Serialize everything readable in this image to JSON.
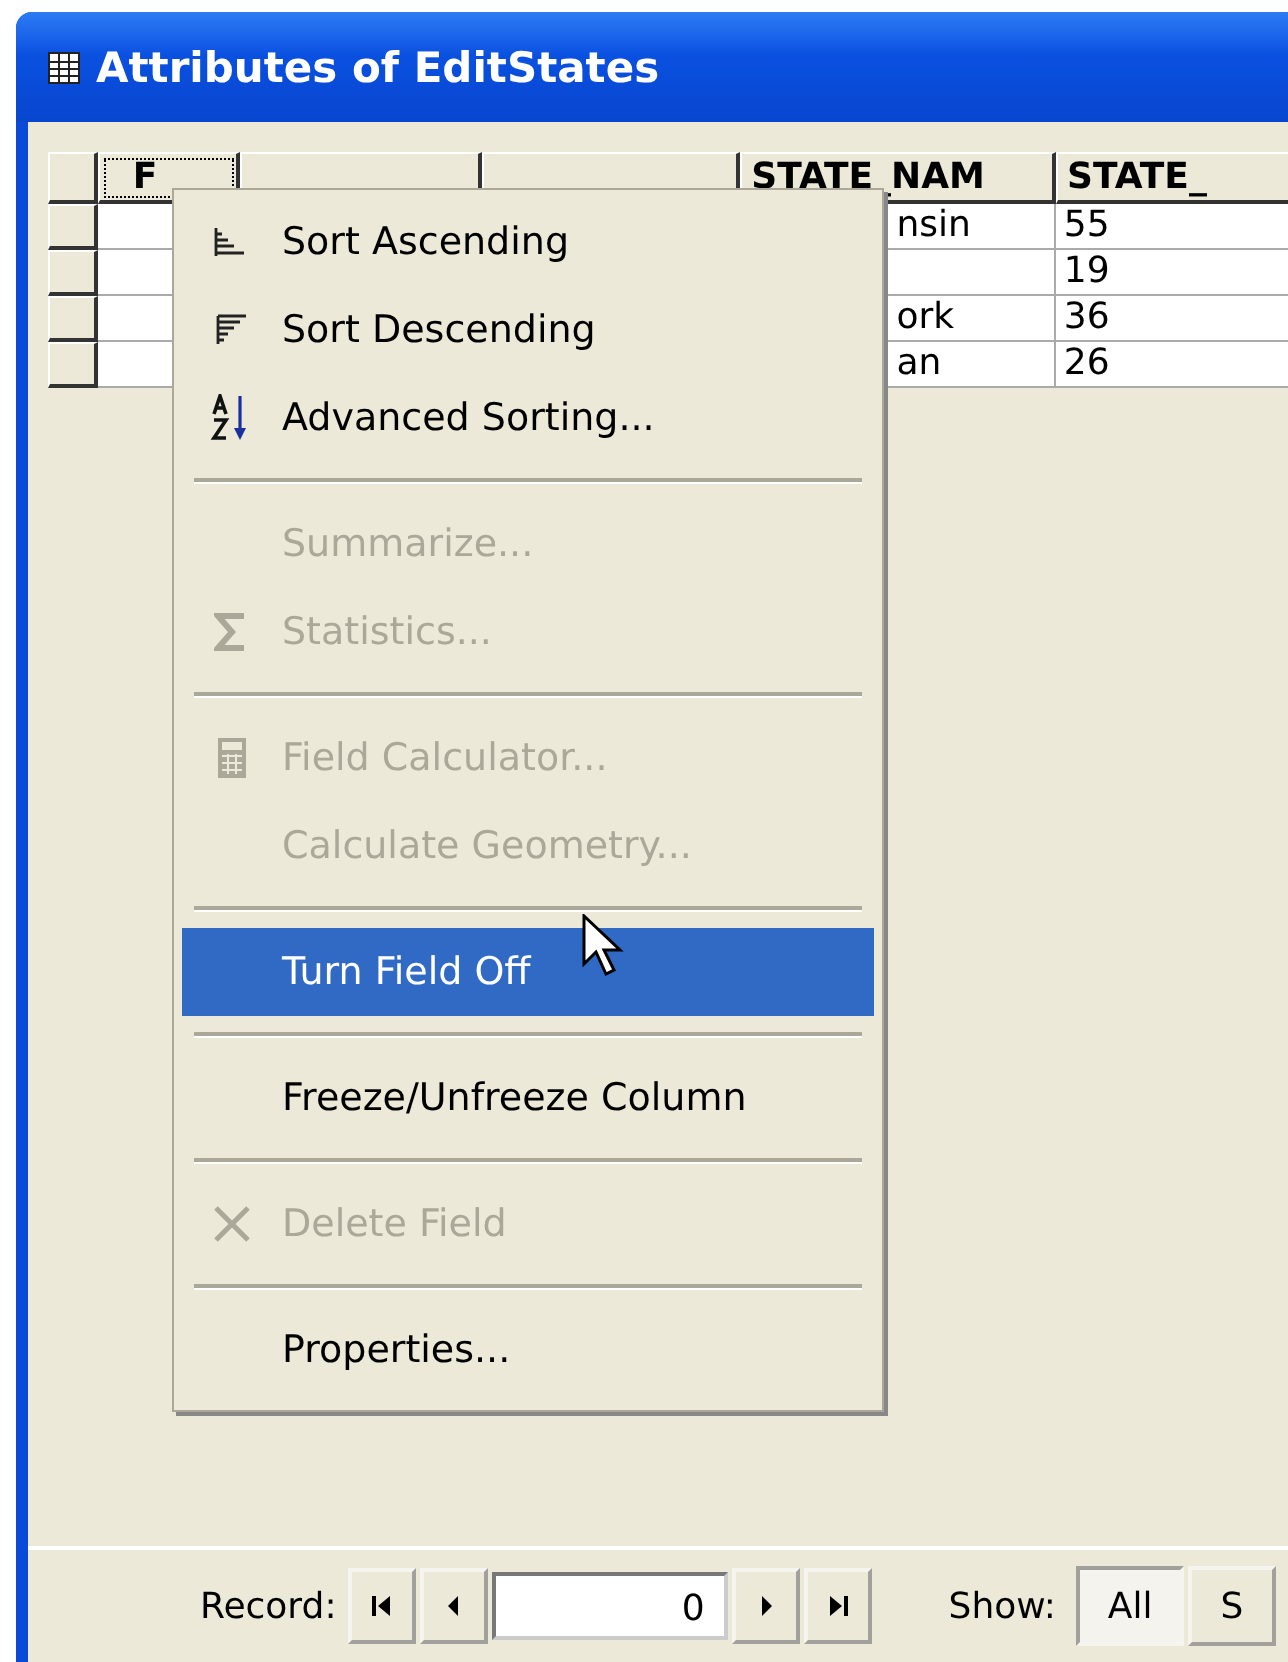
{
  "window": {
    "title": "Attributes of EditStates"
  },
  "table": {
    "columns": [
      {
        "label": "F"
      },
      {},
      {},
      {
        "label": "STATE_NAM"
      },
      {
        "label": "STATE_"
      }
    ],
    "rows": [
      {
        "cells": [
          "",
          "",
          "",
          "nsin",
          "55"
        ]
      },
      {
        "cells": [
          "",
          "",
          "",
          "",
          "19"
        ]
      },
      {
        "cells": [
          "",
          "",
          "",
          "ork",
          "36"
        ]
      },
      {
        "cells": [
          "",
          "",
          "",
          "an",
          "26"
        ]
      }
    ]
  },
  "menu": {
    "items": [
      {
        "kind": "item",
        "label": "Sort Ascending",
        "disabled": false,
        "selected": false
      },
      {
        "kind": "item",
        "label": "Sort Descending",
        "disabled": false,
        "selected": false
      },
      {
        "kind": "item",
        "label": "Advanced Sorting...",
        "disabled": false,
        "selected": false
      },
      {
        "kind": "separator"
      },
      {
        "kind": "item",
        "label": "Summarize...",
        "disabled": true,
        "selected": false
      },
      {
        "kind": "item",
        "label": "Statistics...",
        "disabled": true,
        "selected": false
      },
      {
        "kind": "separator"
      },
      {
        "kind": "item",
        "label": "Field Calculator...",
        "disabled": true,
        "selected": false
      },
      {
        "kind": "item",
        "label": "Calculate Geometry...",
        "disabled": true,
        "selected": false
      },
      {
        "kind": "separator"
      },
      {
        "kind": "item",
        "label": "Turn Field Off",
        "disabled": false,
        "selected": true
      },
      {
        "kind": "separator"
      },
      {
        "kind": "item",
        "label": "Freeze/Unfreeze Column",
        "disabled": false,
        "selected": false
      },
      {
        "kind": "separator"
      },
      {
        "kind": "item",
        "label": "Delete Field",
        "disabled": true,
        "selected": false
      },
      {
        "kind": "separator"
      },
      {
        "kind": "item",
        "label": "Properties...",
        "disabled": false,
        "selected": false
      }
    ]
  },
  "footer": {
    "record_label": "Record:",
    "record_value": "0",
    "show_label": "Show:",
    "show_buttons": [
      {
        "label": "All",
        "selected": true
      },
      {
        "label": "S",
        "selected": false
      }
    ]
  }
}
